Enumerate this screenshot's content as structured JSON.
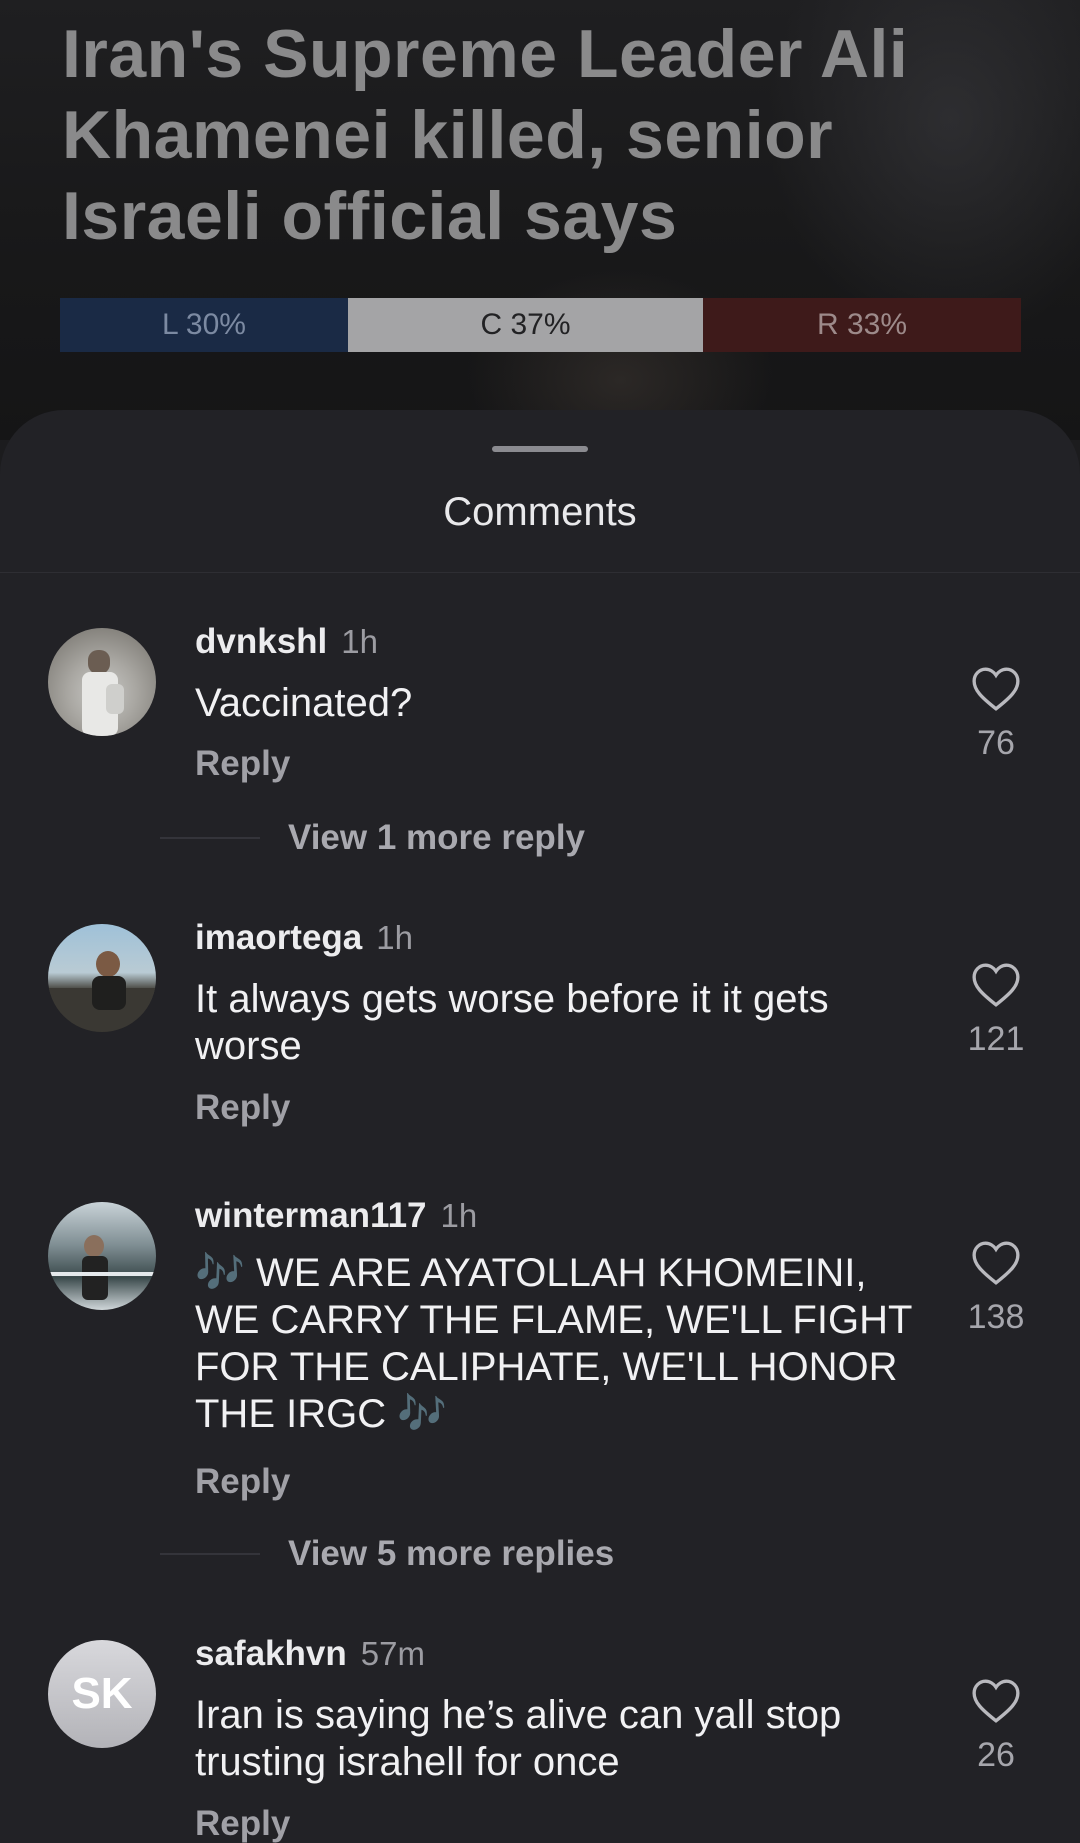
{
  "article": {
    "headline": "Iran's Supreme Leader Ali Khamenei killed, senior Israeli official says",
    "bias": {
      "left_label": "L 30%",
      "center_label": "C 37%",
      "right_label": "R 33%",
      "left": 0.3,
      "center": 0.37,
      "right": 0.33
    }
  },
  "sheet": {
    "title": "Comments"
  },
  "comments": [
    {
      "user": "dvnkshl",
      "time": "1h",
      "text": "Vaccinated?",
      "reply_label": "Reply",
      "likes": "76",
      "view_more": "View 1 more reply"
    },
    {
      "user": "imaortega",
      "time": "1h",
      "text": "It always gets worse before it it gets worse",
      "reply_label": "Reply",
      "likes": "121"
    },
    {
      "user": "winterman117",
      "time": "1h",
      "text_main": "WE ARE AYATOLLAH KHOMEINI, WE CARRY THE FLAME, WE'LL FIGHT FOR THE CALIPHATE, WE'LL HONOR THE IRGC",
      "emoji": "🎶",
      "reply_label": "Reply",
      "likes": "138",
      "view_more": "View 5 more replies"
    },
    {
      "user": "safakhvn",
      "time": "57m",
      "avatar_initials": "SK",
      "text": "Iran is saying he’s alive can yall stop trusting israhell for once",
      "reply_label": "Reply",
      "likes": "26"
    }
  ],
  "colors": {
    "bias_left": "#1a2a45",
    "bias_center": "#a4a4a6",
    "bias_right": "#3e1a1a",
    "sheet_bg": "#222226"
  },
  "icons": [
    "heart-outline-icon",
    "drag-handle-icon"
  ]
}
